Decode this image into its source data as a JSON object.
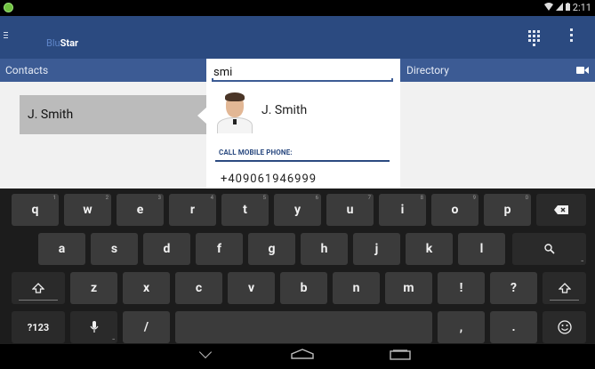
{
  "statusbar": {
    "time": "2:11",
    "notification_icon": "check-circle-icon",
    "icons": [
      "wifi-icon",
      "signal-icon",
      "battery-icon"
    ]
  },
  "appbar": {
    "logo_prefix": "Blu",
    "logo_suffix": "Star",
    "menu_icon": "hamburger-icon",
    "keypad_icon": "dialpad-icon",
    "overflow_icon": "overflow-menu-icon"
  },
  "subheader": {
    "contacts": "Contacts",
    "directory": "Directory",
    "video_icon": "video-camera-icon"
  },
  "search": {
    "value": "smi"
  },
  "results": [
    {
      "name": "J. Smith"
    }
  ],
  "popup": {
    "name": "J. Smith",
    "label": "CALL MOBILE PHONE:",
    "phone": "+409061946999"
  },
  "keyboard": {
    "row1": [
      {
        "k": "q",
        "h": "1"
      },
      {
        "k": "w",
        "h": "2"
      },
      {
        "k": "e",
        "h": "3"
      },
      {
        "k": "r",
        "h": "4"
      },
      {
        "k": "t",
        "h": "5"
      },
      {
        "k": "y",
        "h": "6"
      },
      {
        "k": "u",
        "h": "7"
      },
      {
        "k": "i",
        "h": "8"
      },
      {
        "k": "o",
        "h": "9"
      },
      {
        "k": "p",
        "h": "0"
      }
    ],
    "row2": [
      "a",
      "s",
      "d",
      "f",
      "g",
      "h",
      "j",
      "k",
      "l"
    ],
    "row3": [
      "z",
      "x",
      "c",
      "v",
      "b",
      "n",
      "m",
      "!",
      "?"
    ],
    "symbols_key": "?123",
    "slash_key": "/",
    "comma_key": ",",
    "period_key": ".",
    "icons": {
      "backspace": "backspace-icon",
      "search": "search-icon",
      "shift": "shift-icon",
      "mic": "microphone-icon",
      "emoji": "emoji-icon"
    }
  },
  "navbar": {
    "back": "back-icon",
    "home": "home-icon",
    "recents": "recents-icon"
  }
}
